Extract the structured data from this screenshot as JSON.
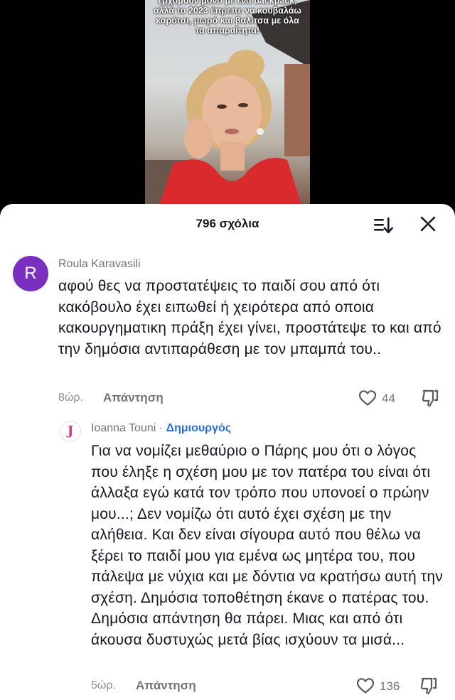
{
  "video": {
    "caption_lines": [
      "έρχομουν μόνο με ένα backpack,",
      "αλλά το 2023 έπρεπε να κουβαλάω",
      "καρότσι, μωρό και βαλίτσα με όλα",
      "τα απαραίτητα!"
    ]
  },
  "comments_panel": {
    "count_label": "796 σχόλια",
    "sort_icon": "sort-icon",
    "close_icon": "close-icon"
  },
  "comments": [
    {
      "avatar_letter": "R",
      "avatar_color": "#7b2fbe",
      "username": "Roula Karavasili",
      "text": "αφού θες να προστατέψεις το παιδί σου από ότι κακόβουλο έχει ειπωθεί ή χειρότερα από οποια κακουργηματικη πράξη έχει γίνει, προστάτεψε το και από την δημόσια αντιπαράθεση με τον μπαμπά του..",
      "time": "8ώρ.",
      "reply_label": "Απάντηση",
      "likes": "44"
    },
    {
      "avatar_letter": "J",
      "avatar_color": "#e0317d",
      "username": "Ioanna Touni",
      "separator": "·",
      "creator_badge": "Δημιουργός",
      "text": "Για να νομίζει μεθαύριο ο Πάρης μου ότι ο λόγος που έληξε η σχέση μου με τον πατέρα του είναι ότι άλλαξα εγώ κατά τον τρόπο που υπονοεί ο πρώην μου...; Δεν νομίζω ότι αυτό έχει σχέση με την αλήθεια. Και δεν είναι σίγουρα αυτό που θέλω να ξέρει το παιδί μου για εμένα ως μητέρα του, που πάλεψα με νύχια και με δόντια να κρατήσω αυτή την σχέση. Δημόσια τοποθέτηση έκανε ο πατέρας του. Δημόσια απάντηση θα πάρει. Μιας και από ότι άκουσα δυστυχώς μετά βίας ισχύουν τα μισά...",
      "time": "5ώρ.",
      "reply_label": "Απάντηση",
      "likes": "136"
    }
  ]
}
